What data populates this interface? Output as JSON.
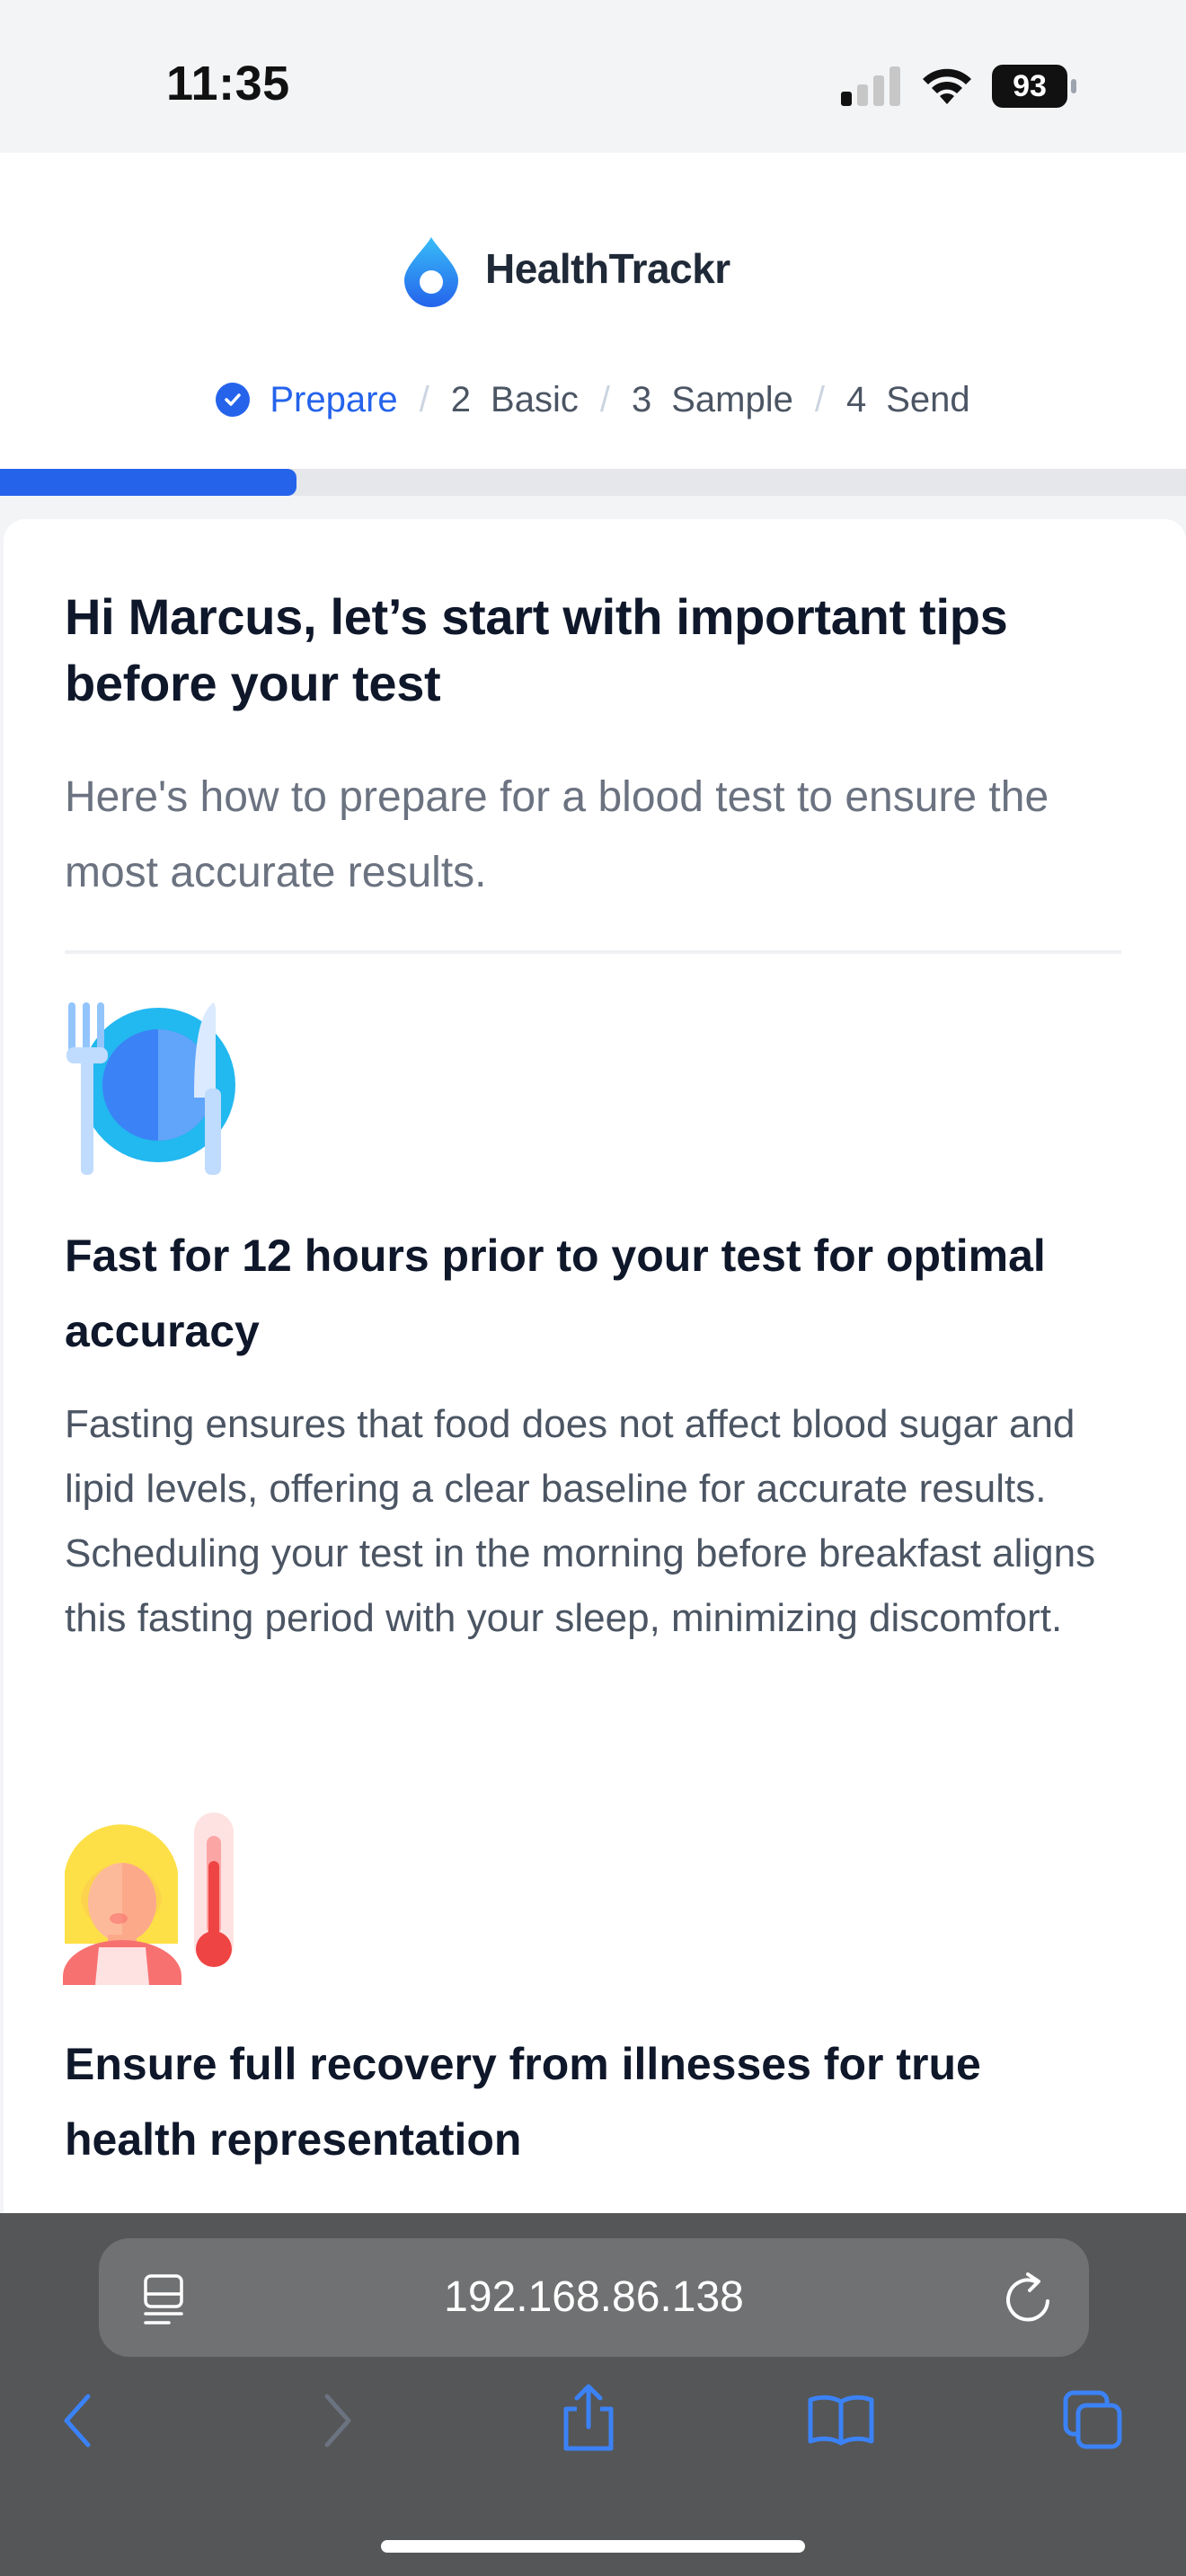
{
  "status_bar": {
    "time": "11:35",
    "battery": "93"
  },
  "header": {
    "brand": "HealthTrackr"
  },
  "steps": [
    {
      "num": "",
      "label": "Prepare",
      "state": "done"
    },
    {
      "num": "2",
      "label": "Basic",
      "state": "todo"
    },
    {
      "num": "3",
      "label": "Sample",
      "state": "todo"
    },
    {
      "num": "4",
      "label": "Send",
      "state": "todo"
    }
  ],
  "progress": {
    "fraction": 0.25
  },
  "content": {
    "greeting": "Hi Marcus, let’s start with important tips before your test",
    "intro": "Here's how to prepare for a blood test to ensure the most accurate results.",
    "tips": [
      {
        "icon": "plate-fork-knife-icon",
        "title": "Fast for 12 hours prior to your test for optimal accuracy",
        "body": "Fasting ensures that food does not affect blood sugar and lipid levels, offering a clear baseline for accurate results. Scheduling your test in the morning before breakfast aligns this fasting period with your sleep, minimizing discomfort."
      },
      {
        "icon": "sick-person-thermometer-icon",
        "title": "Ensure full recovery from illnesses for true health representation"
      }
    ]
  },
  "browser": {
    "url": "192.168.86.138"
  },
  "colors": {
    "accent": "#2563eb",
    "track": "#e5e7eb",
    "browser_bg": "#555657"
  }
}
